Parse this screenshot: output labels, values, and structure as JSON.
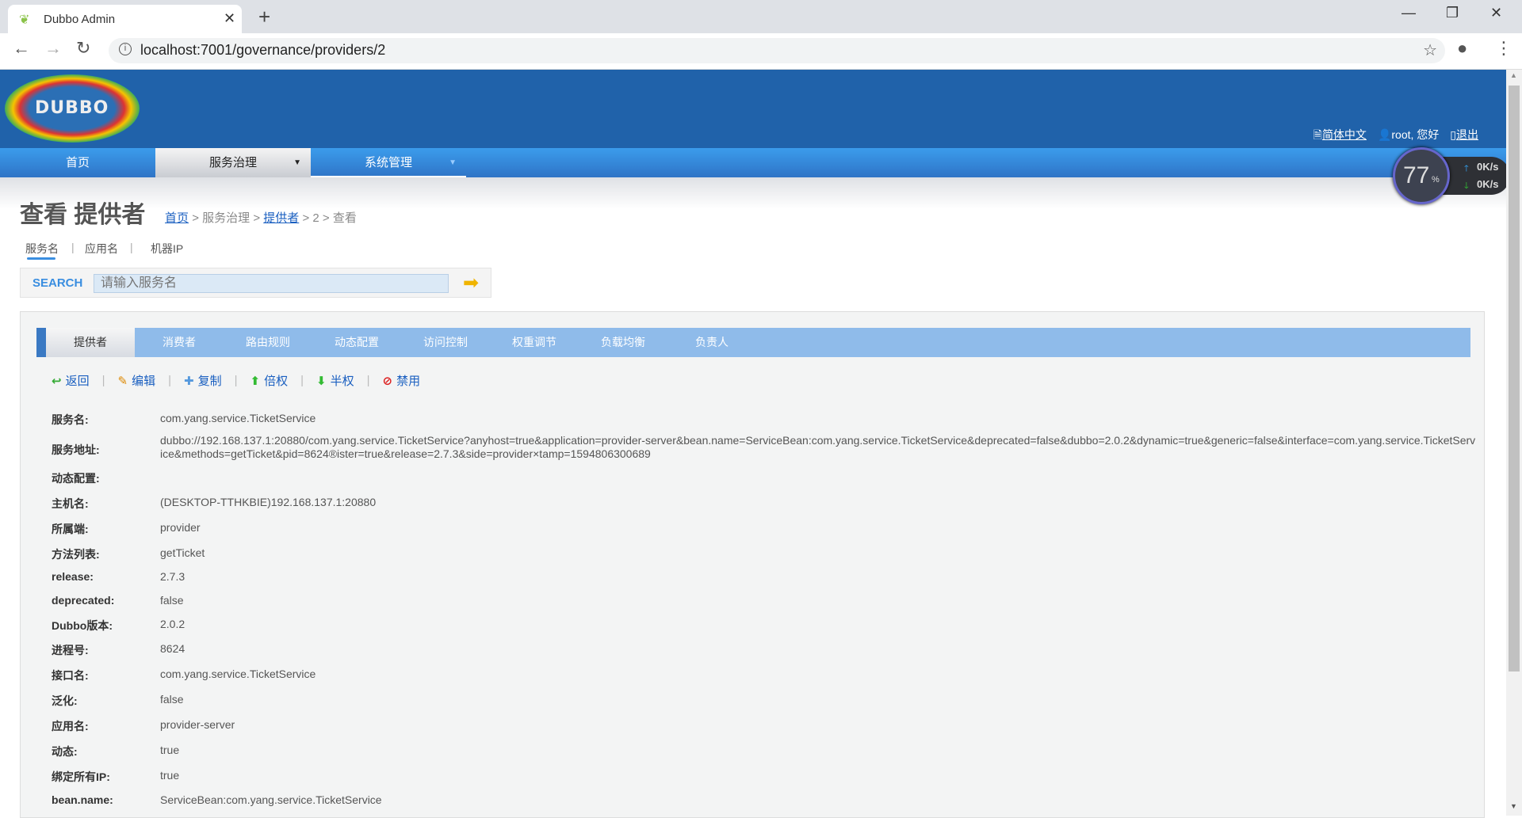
{
  "browser": {
    "tab_title": "Dubbo Admin",
    "url": "localhost:7001/governance/providers/2"
  },
  "header": {
    "logo": "DUBBO",
    "language": "简体中文",
    "user": "root, 您好",
    "logout": "退出"
  },
  "nav": [
    {
      "label": "首页"
    },
    {
      "label": "服务治理"
    },
    {
      "label": "系统管理"
    }
  ],
  "page": {
    "title": "查看 提供者",
    "breadcrumb": {
      "home": "首页",
      "sep": ">",
      "section": "服务治理",
      "providers": "提供者",
      "id": "2",
      "current": "查看"
    }
  },
  "filter_tabs": [
    "服务名",
    "应用名",
    "机器IP"
  ],
  "search": {
    "label": "SEARCH",
    "placeholder": "请输入服务名"
  },
  "panel_tabs": [
    "提供者",
    "消费者",
    "路由规则",
    "动态配置",
    "访问控制",
    "权重调节",
    "负载均衡",
    "负责人"
  ],
  "actions": [
    "返回",
    "编辑",
    "复制",
    "倍权",
    "半权",
    "禁用"
  ],
  "details": [
    {
      "label": "服务名:",
      "value": "com.yang.service.TicketService"
    },
    {
      "label": "服务地址:",
      "value": "dubbo://192.168.137.1:20880/com.yang.service.TicketService?anyhost=true&application=provider-server&bean.name=ServiceBean:com.yang.service.TicketService&deprecated=false&dubbo=2.0.2&dynamic=true&generic=false&interface=com.yang.service.TicketService&methods=getTicket&pid=8624®ister=true&release=2.7.3&side=provider×tamp=1594806300689"
    },
    {
      "label": "动态配置:",
      "value": ""
    },
    {
      "label": "主机名:",
      "value": "(DESKTOP-TTHKBIE)192.168.137.1:20880"
    },
    {
      "label": "所属端:",
      "value": "provider"
    },
    {
      "label": "方法列表:",
      "value": "getTicket"
    },
    {
      "label": "release:",
      "value": "2.7.3"
    },
    {
      "label": "deprecated:",
      "value": "false"
    },
    {
      "label": "Dubbo版本:",
      "value": "2.0.2"
    },
    {
      "label": "进程号:",
      "value": "8624"
    },
    {
      "label": "接口名:",
      "value": "com.yang.service.TicketService"
    },
    {
      "label": "泛化:",
      "value": "false"
    },
    {
      "label": "应用名:",
      "value": "provider-server"
    },
    {
      "label": "动态:",
      "value": "true"
    },
    {
      "label": "绑定所有IP:",
      "value": "true"
    },
    {
      "label": "bean.name:",
      "value": "ServiceBean:com.yang.service.TicketService"
    }
  ],
  "widget": {
    "percent": "77",
    "pct_sign": "%",
    "up": "0K/s",
    "down": "0K/s"
  }
}
